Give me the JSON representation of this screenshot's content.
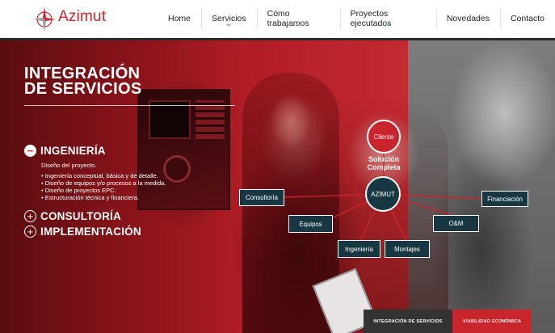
{
  "brand": {
    "name": "Azimut",
    "color": "#c9252c",
    "icon": "compass-rose-icon"
  },
  "nav": {
    "items": [
      {
        "label": "Home",
        "has_submenu": false
      },
      {
        "label": "Servicios",
        "has_submenu": true
      },
      {
        "label": "Cómo trabajamos",
        "has_submenu": true
      },
      {
        "label": "Proyectos ejecutados",
        "has_submenu": true
      },
      {
        "label": "Novedades",
        "has_submenu": false
      },
      {
        "label": "Contacto",
        "has_submenu": false
      }
    ]
  },
  "hero": {
    "title_line1": "INTEGRACIÓN",
    "title_line2": "DE SERVICIOS",
    "sections": [
      {
        "label": "INGENIERÍA",
        "expanded": true,
        "icon": "minus-circle-icon",
        "description": "Diseño del proyecto.",
        "bullets": [
          "Ingeniería conceptual, básica y de detalle.",
          "Diseño de equipos y/o procesos a la medida.",
          "Diseño de proyectos EPC.",
          "Estructuración técnica y financiera."
        ]
      },
      {
        "label": "CONSULTORÍA",
        "expanded": false,
        "icon": "plus-circle-icon"
      },
      {
        "label": "IMPLEMENTACIÓN",
        "expanded": false,
        "icon": "plus-circle-icon"
      }
    ]
  },
  "diagram": {
    "client": "Cliente",
    "solution_line1": "Solución",
    "solution_line2": "Completa",
    "center": "AZIMUT",
    "nodes": {
      "consultoria": "Consultoría",
      "equipos": "Equipos",
      "ingenieria": "Ingeniería",
      "montajes": "Montajes",
      "om": "O&M",
      "financiacion": "Financiación"
    },
    "colors": {
      "node": "#173843",
      "link": "#c9252c",
      "client": "#c9252c"
    }
  },
  "tabs": [
    {
      "label": "INTEGRACIÓN DE SERVICIOS",
      "active": true
    },
    {
      "label": "VIABILIDAD ECONÓMICA",
      "active": false
    }
  ]
}
